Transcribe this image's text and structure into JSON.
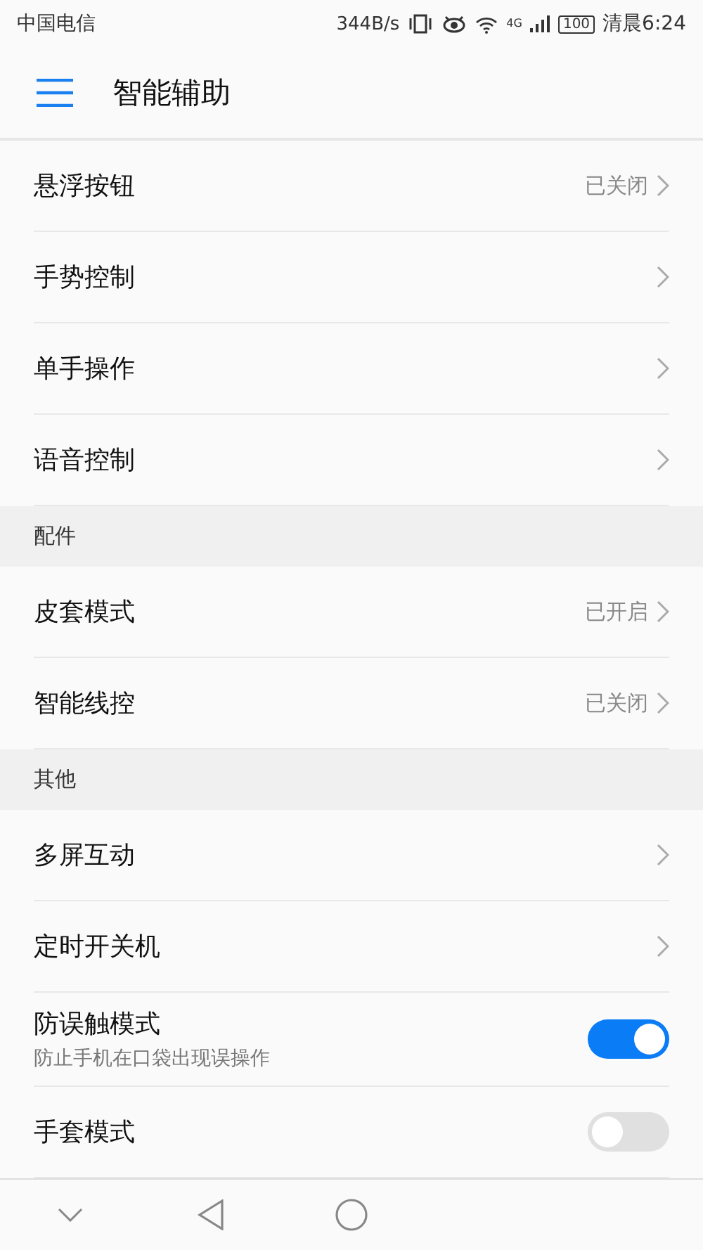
{
  "status_bar": {
    "carrier": "中国电信",
    "speed": "344B/s",
    "network": "4G",
    "battery": "100",
    "time": "清晨6:24"
  },
  "header": {
    "title": "智能辅助"
  },
  "sections": [
    {
      "items": [
        {
          "kind": "link",
          "label": "悬浮按钮",
          "value": "已关闭"
        },
        {
          "kind": "link",
          "label": "手势控制"
        },
        {
          "kind": "link",
          "label": "单手操作"
        },
        {
          "kind": "link",
          "label": "语音控制"
        }
      ]
    },
    {
      "title": "配件",
      "items": [
        {
          "kind": "link",
          "label": "皮套模式",
          "value": "已开启"
        },
        {
          "kind": "link",
          "label": "智能线控",
          "value": "已关闭"
        }
      ]
    },
    {
      "title": "其他",
      "items": [
        {
          "kind": "link",
          "label": "多屏互动"
        },
        {
          "kind": "link",
          "label": "定时开关机"
        },
        {
          "kind": "switch",
          "label": "防误触模式",
          "subtitle": "防止手机在口袋出现误操作",
          "on": true
        },
        {
          "kind": "switch",
          "label": "手套模式",
          "on": false
        }
      ]
    }
  ]
}
